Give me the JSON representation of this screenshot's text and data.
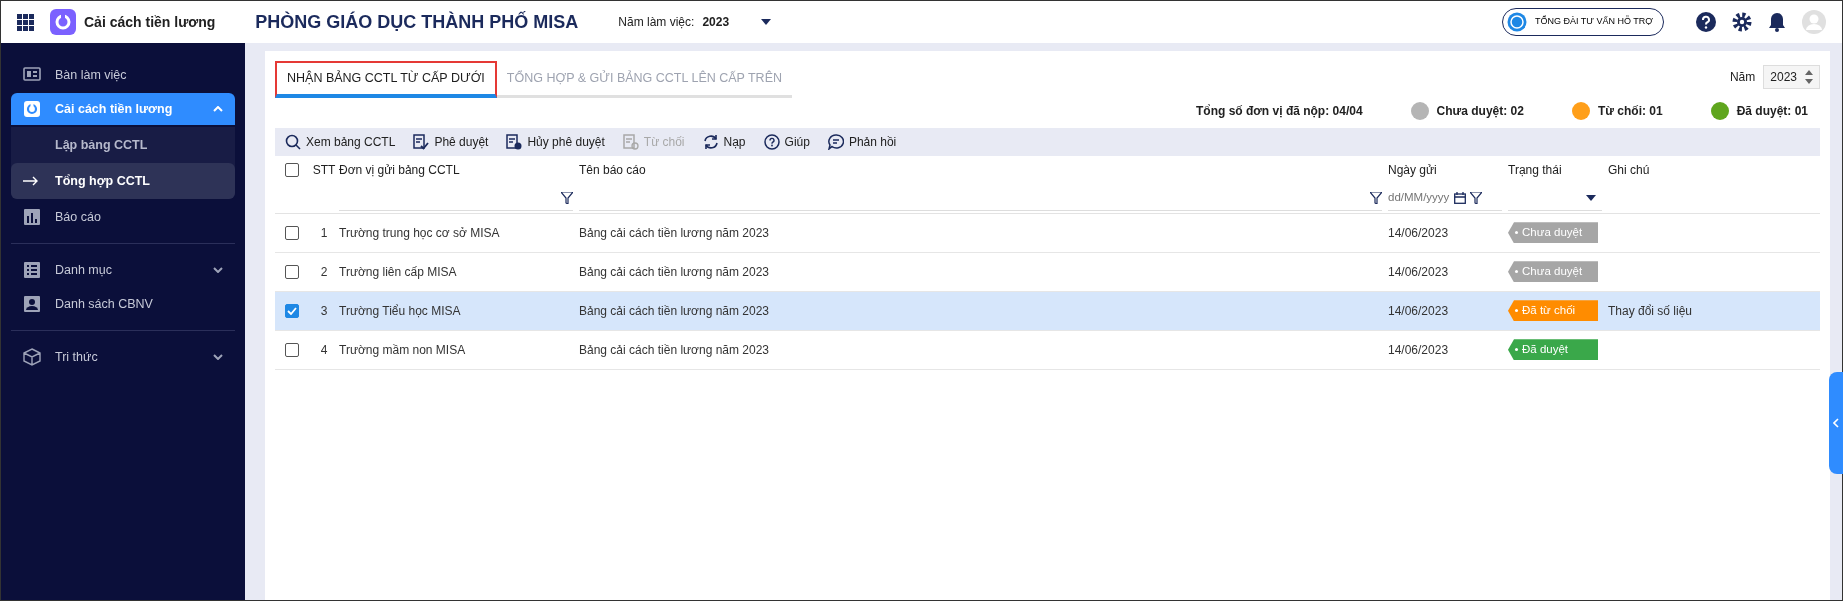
{
  "app": {
    "name": "Cải cách tiền lương",
    "org_title": "PHÒNG GIÁO DỤC THÀNH PHỐ MISA",
    "year_label": "Năm làm việc:",
    "year_value": "2023",
    "support_label": "TỔNG ĐÀI TƯ VẤN HỖ TRỢ"
  },
  "sidebar": {
    "items": [
      {
        "kind": "item",
        "label": "Bàn làm việc",
        "selected": false
      },
      {
        "kind": "group",
        "label": "Cải cách tiền lương",
        "selected": true,
        "expanded": true,
        "children": [
          {
            "label": "Lập bảng CCTL",
            "selected": false
          },
          {
            "label": "Tổng hợp CCTL",
            "selected": true
          }
        ]
      },
      {
        "kind": "item",
        "label": "Báo cáo",
        "selected": false
      },
      {
        "kind": "divider"
      },
      {
        "kind": "group",
        "label": "Danh mục",
        "selected": false,
        "expanded": false
      },
      {
        "kind": "item",
        "label": "Danh sách CBNV",
        "selected": false
      },
      {
        "kind": "divider"
      },
      {
        "kind": "group",
        "label": "Tri thức",
        "selected": false,
        "expanded": false
      }
    ]
  },
  "tabs": [
    {
      "label": "NHẬN BẢNG CCTL TỪ CẤP DƯỚI",
      "selected": true
    },
    {
      "label": "TỔNG HỢP & GỬI BẢNG CCTL LÊN CẤP TRÊN",
      "selected": false
    }
  ],
  "year_filter": {
    "label": "Năm",
    "value": "2023"
  },
  "summary": {
    "total": "Tổng số đơn vị đã nộp: 04/04",
    "legend": [
      {
        "label": "Chưa duyệt: 02",
        "color": "#b5b5b5"
      },
      {
        "label": "Từ chối: 01",
        "color": "#ff9f1a"
      },
      {
        "label": "Đã duyệt: 01",
        "color": "#5fa61e"
      }
    ]
  },
  "toolbar": [
    {
      "kind": "search",
      "label": "Xem bảng CCTL",
      "disabled": false
    },
    {
      "kind": "approve",
      "label": "Phê duyệt",
      "disabled": false
    },
    {
      "kind": "cancel",
      "label": "Hủy phê duyệt",
      "disabled": false
    },
    {
      "kind": "reject",
      "label": "Từ chối",
      "disabled": true
    },
    {
      "kind": "reload",
      "label": "Nạp",
      "disabled": false
    },
    {
      "kind": "help",
      "label": "Giúp",
      "disabled": false
    },
    {
      "kind": "chat",
      "label": "Phản hồi",
      "disabled": false
    }
  ],
  "table": {
    "select_all_checked": false,
    "columns": [
      "STT",
      "Đơn vị gửi bảng CCTL",
      "Tên báo cáo",
      "Ngày gửi",
      "Trạng thái",
      "Ghi chú"
    ],
    "date_filter_placeholder": "dd/MM/yyyy",
    "rows": [
      {
        "stt": "1",
        "unit": "Trường trung học cơ sở MISA",
        "report": "Bảng cải cách tiền lương năm 2023",
        "date": "14/06/2023",
        "status": "Chưa duyệt",
        "color": "#a6a6a6",
        "checked": false,
        "selected": false
      },
      {
        "stt": "2",
        "unit": "Trường liên cấp MISA",
        "report": "Bảng cải cách tiền lương năm 2023",
        "date": "14/06/2023",
        "status": "Chưa duyệt",
        "color": "#a6a6a6",
        "checked": false,
        "selected": false
      },
      {
        "stt": "3",
        "unit": "Trường Tiểu học MISA",
        "report": "Bảng cải cách tiền lương năm 2023",
        "date": "14/06/2023",
        "status": "Đã từ chối",
        "color": "#ff8c00",
        "note": "Thay đổi số liệu",
        "checked": true,
        "selected": true
      },
      {
        "stt": "4",
        "unit": "Trường mầm non MISA",
        "report": "Bảng cải cách tiền lương năm 2023",
        "date": "14/06/2023",
        "status": "Đã duyệt",
        "color": "#3aa84a",
        "checked": false,
        "selected": false
      }
    ]
  }
}
